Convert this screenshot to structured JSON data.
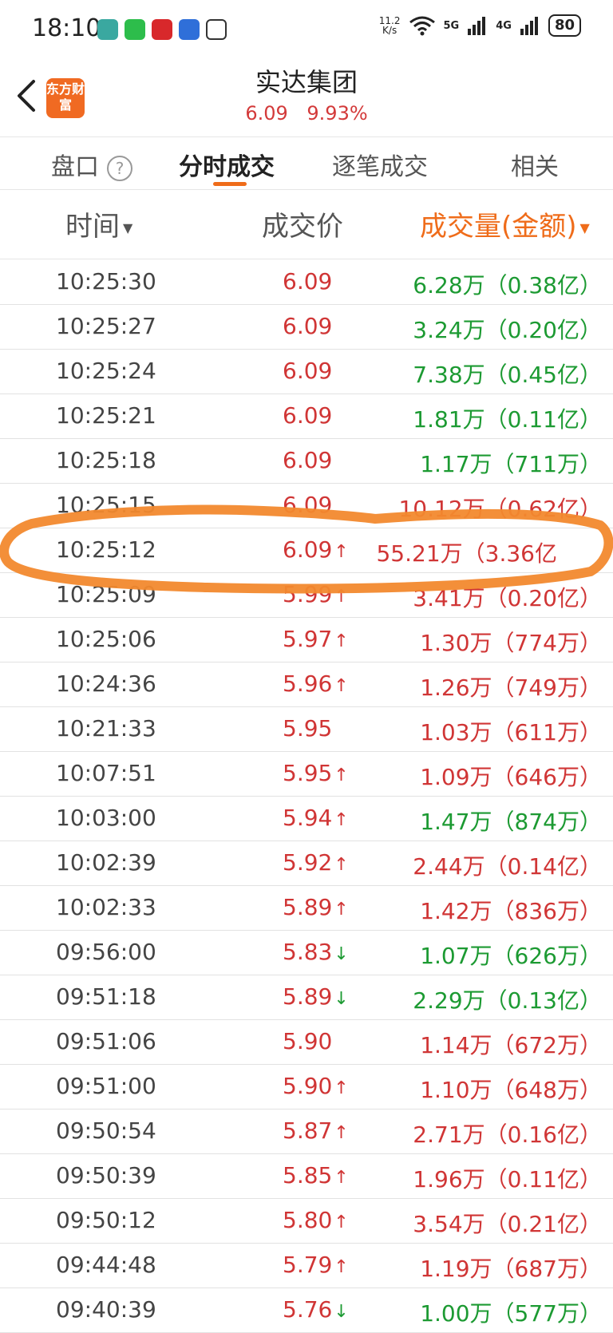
{
  "status_bar": {
    "time": "18:10",
    "net_speed_value": "11.2",
    "net_speed_unit": "K/s",
    "signal_1": "5G",
    "signal_2": "4G",
    "battery": "80"
  },
  "header": {
    "logo_text": "东方财富",
    "title": "实达集团",
    "price": "6.09",
    "change_pct": "9.93%"
  },
  "tabs": [
    {
      "label": "盘口",
      "active": false
    },
    {
      "label": "分时成交",
      "active": true
    },
    {
      "label": "逐笔成交",
      "active": false
    },
    {
      "label": "相关",
      "active": false
    }
  ],
  "columns": {
    "time": "时间",
    "price": "成交价",
    "volume": "成交量(金额)"
  },
  "rows": [
    {
      "time": "10:25:30",
      "price": "6.09",
      "arrow": "",
      "volume": "6.28万（0.38亿）",
      "price_color": "up",
      "vol_color": "down"
    },
    {
      "time": "10:25:27",
      "price": "6.09",
      "arrow": "",
      "volume": "3.24万（0.20亿）",
      "price_color": "up",
      "vol_color": "down"
    },
    {
      "time": "10:25:24",
      "price": "6.09",
      "arrow": "",
      "volume": "7.38万（0.45亿）",
      "price_color": "up",
      "vol_color": "down"
    },
    {
      "time": "10:25:21",
      "price": "6.09",
      "arrow": "",
      "volume": "1.81万（0.11亿）",
      "price_color": "up",
      "vol_color": "down"
    },
    {
      "time": "10:25:18",
      "price": "6.09",
      "arrow": "",
      "volume": "1.17万（711万）",
      "price_color": "up",
      "vol_color": "down"
    },
    {
      "time": "10:25:15",
      "price": "6.09",
      "arrow": "",
      "volume": "10.12万（0.62亿）",
      "price_color": "up",
      "vol_color": "up"
    },
    {
      "time": "10:25:12",
      "price": "6.09",
      "arrow": "↑",
      "volume": "55.21万（3.36亿",
      "price_color": "up",
      "vol_color": "up"
    },
    {
      "time": "10:25:09",
      "price": "5.99",
      "arrow": "↑",
      "volume": "3.41万（0.20亿）",
      "price_color": "up",
      "vol_color": "up"
    },
    {
      "time": "10:25:06",
      "price": "5.97",
      "arrow": "↑",
      "volume": "1.30万（774万）",
      "price_color": "up",
      "vol_color": "up"
    },
    {
      "time": "10:24:36",
      "price": "5.96",
      "arrow": "↑",
      "volume": "1.26万（749万）",
      "price_color": "up",
      "vol_color": "up"
    },
    {
      "time": "10:21:33",
      "price": "5.95",
      "arrow": "",
      "volume": "1.03万（611万）",
      "price_color": "up",
      "vol_color": "up"
    },
    {
      "time": "10:07:51",
      "price": "5.95",
      "arrow": "↑",
      "volume": "1.09万（646万）",
      "price_color": "up",
      "vol_color": "up"
    },
    {
      "time": "10:03:00",
      "price": "5.94",
      "arrow": "↑",
      "volume": "1.47万（874万）",
      "price_color": "up",
      "vol_color": "down"
    },
    {
      "time": "10:02:39",
      "price": "5.92",
      "arrow": "↑",
      "volume": "2.44万（0.14亿）",
      "price_color": "up",
      "vol_color": "up"
    },
    {
      "time": "10:02:33",
      "price": "5.89",
      "arrow": "↑",
      "volume": "1.42万（836万）",
      "price_color": "up",
      "vol_color": "up"
    },
    {
      "time": "09:56:00",
      "price": "5.83",
      "arrow": "↓",
      "volume": "1.07万（626万）",
      "price_color": "up",
      "vol_color": "down"
    },
    {
      "time": "09:51:18",
      "price": "5.89",
      "arrow": "↓",
      "volume": "2.29万（0.13亿）",
      "price_color": "up",
      "vol_color": "down"
    },
    {
      "time": "09:51:06",
      "price": "5.90",
      "arrow": "",
      "volume": "1.14万（672万）",
      "price_color": "up",
      "vol_color": "up"
    },
    {
      "time": "09:51:00",
      "price": "5.90",
      "arrow": "↑",
      "volume": "1.10万（648万）",
      "price_color": "up",
      "vol_color": "up"
    },
    {
      "time": "09:50:54",
      "price": "5.87",
      "arrow": "↑",
      "volume": "2.71万（0.16亿）",
      "price_color": "up",
      "vol_color": "up"
    },
    {
      "time": "09:50:39",
      "price": "5.85",
      "arrow": "↑",
      "volume": "1.96万（0.11亿）",
      "price_color": "up",
      "vol_color": "up"
    },
    {
      "time": "09:50:12",
      "price": "5.80",
      "arrow": "↑",
      "volume": "3.54万（0.21亿）",
      "price_color": "up",
      "vol_color": "up"
    },
    {
      "time": "09:44:48",
      "price": "5.79",
      "arrow": "↑",
      "volume": "1.19万（687万）",
      "price_color": "up",
      "vol_color": "up"
    },
    {
      "time": "09:40:39",
      "price": "5.76",
      "arrow": "↓",
      "volume": "1.00万（577万）",
      "price_color": "up",
      "vol_color": "down"
    }
  ],
  "colors": {
    "up": "#d03535",
    "down": "#1c9a32",
    "accent": "#ef6c1a",
    "logo": "#f06a22"
  }
}
